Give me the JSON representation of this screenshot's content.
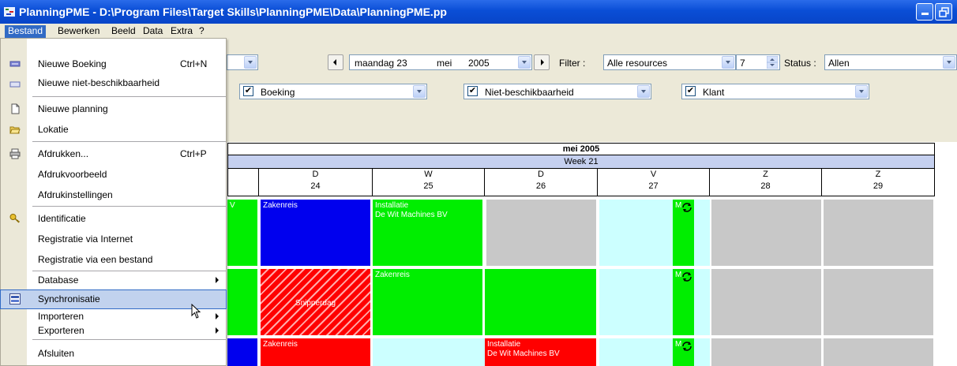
{
  "window": {
    "title": "PlanningPME - D:\\Program Files\\Target Skills\\PlanningPME\\Data\\PlanningPME.pp"
  },
  "menubar": [
    {
      "label": "Bestand",
      "active": true
    },
    {
      "label": "Bewerken"
    },
    {
      "label": "Beeld"
    },
    {
      "label": "Data"
    },
    {
      "label": "Extra"
    },
    {
      "label": "?"
    }
  ],
  "toolbar": {
    "date": {
      "weekday_day": "maandag 23",
      "month": "mei",
      "year": "2005"
    },
    "filter_label": "Filter :",
    "filter_value": "Alle resources",
    "count_value": "7",
    "status_label": "Status :",
    "status_value": "Allen",
    "type_filters": [
      {
        "label": "Boeking",
        "checked": true
      },
      {
        "label": "Niet-beschikbaarheid",
        "checked": true
      },
      {
        "label": "Klant",
        "checked": true
      }
    ]
  },
  "file_menu": {
    "items": [
      {
        "label": "Nieuwe Boeking",
        "shortcut": "Ctrl+N",
        "icon": "booking-icon"
      },
      {
        "label": "Nieuwe niet-beschikbaarheid",
        "icon": "unavailability-icon"
      },
      {
        "label": "Nieuwe planning",
        "icon": "new-document-icon"
      },
      {
        "label": "Lokatie",
        "icon": "open-folder-icon"
      },
      {
        "label": "Afdrukken...",
        "shortcut": "Ctrl+P",
        "icon": "printer-icon"
      },
      {
        "label": "Afdrukvoorbeeld"
      },
      {
        "label": "Afdrukinstellingen"
      },
      {
        "label": "Identificatie",
        "icon": "key-icon"
      },
      {
        "label": "Registratie via Internet"
      },
      {
        "label": "Registratie via een bestand"
      },
      {
        "label": "Database",
        "submenu": true
      },
      {
        "label": "Synchronisatie",
        "icon": "sync-icon",
        "selected": true
      },
      {
        "label": "Importeren",
        "submenu": true
      },
      {
        "label": "Exporteren",
        "submenu": true
      },
      {
        "label": "Afsluiten"
      }
    ]
  },
  "calendar": {
    "month": "mei 2005",
    "week": "Week 21",
    "days": [
      {
        "letter": "D",
        "num": "24"
      },
      {
        "letter": "W",
        "num": "25"
      },
      {
        "letter": "D",
        "num": "26"
      },
      {
        "letter": "V",
        "num": "27"
      },
      {
        "letter": "Z",
        "num": "28"
      },
      {
        "letter": "Z",
        "num": "29"
      }
    ],
    "cells": {
      "r1_partial": "V",
      "r1_tue": "Zakenreis",
      "r1_wed_line1": "Installatie",
      "r1_wed_line2": "De Wit Machines BV",
      "r2_tue": "Snipperdag",
      "r2_wed": "Zakenreis",
      "r3_tue": "Zakenreis",
      "r3_thu_line1": "Installatie",
      "r3_thu_line2": "De Wit Machines BV"
    },
    "sync_marker": "M"
  },
  "colors": {
    "booking_green": "#00ee00",
    "business_trip_blue": "#0000ee",
    "red": "#ff0000",
    "weekend_grey": "#c8c8c8",
    "free_cyan": "#ccffff",
    "menu_highlight": "#c1d2ee"
  }
}
